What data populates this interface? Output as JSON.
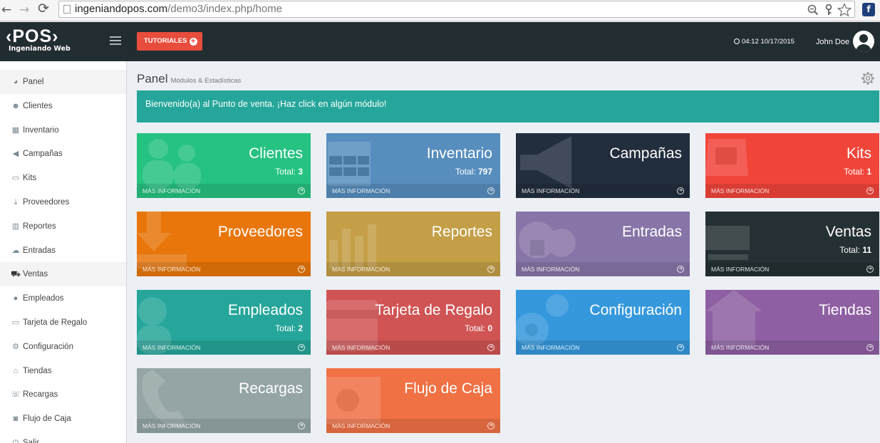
{
  "browser": {
    "url_host": "ingeniandopos.com",
    "url_path": "/demo3/index.php/home",
    "back_glyph": "←",
    "forward_glyph": "→",
    "reload_glyph": "⟳",
    "ext_glyph": "f"
  },
  "header": {
    "logo_main": "‹POS›",
    "logo_sub": "Ingeniando Web",
    "tutorial_label": "TUTORIALES",
    "tutorial_plus": "+",
    "datetime": "04:12 10/17/2015",
    "user_name": "John Doe"
  },
  "sidebar": {
    "items": [
      {
        "label": "Panel",
        "icon": "tachometer-icon",
        "glyph": "◕"
      },
      {
        "label": "Clientes",
        "icon": "users-icon",
        "glyph": "☻"
      },
      {
        "label": "Inventario",
        "icon": "table-icon",
        "glyph": "▦"
      },
      {
        "label": "Campañas",
        "icon": "bullhorn-icon",
        "glyph": "◀"
      },
      {
        "label": "Kits",
        "icon": "inbox-icon",
        "glyph": "▭"
      },
      {
        "label": "Proveedores",
        "icon": "download-icon",
        "glyph": "⤓"
      },
      {
        "label": "Reportes",
        "icon": "bar-chart-icon",
        "glyph": "▥"
      },
      {
        "label": "Entradas",
        "icon": "cloud-download-icon",
        "glyph": "☁"
      },
      {
        "label": "Ventas",
        "icon": "shopping-cart-icon",
        "glyph": "⛟"
      },
      {
        "label": "Empleados",
        "icon": "user-icon",
        "glyph": "●"
      },
      {
        "label": "Tarjeta de Regalo",
        "icon": "credit-card-icon",
        "glyph": "▭"
      },
      {
        "label": "Configuración",
        "icon": "cogs-icon",
        "glyph": "⚙"
      },
      {
        "label": "Tiendas",
        "icon": "home-icon",
        "glyph": "⌂"
      },
      {
        "label": "Recargas",
        "icon": "phone-icon",
        "glyph": "☏"
      },
      {
        "label": "Flujo de Caja",
        "icon": "money-icon",
        "glyph": "◙"
      },
      {
        "label": "Salir",
        "icon": "power-off-icon",
        "glyph": "⏻"
      }
    ]
  },
  "main": {
    "title": "Panel",
    "subtitle": "Módulos & Estadísticas",
    "welcome": "Bienvenido(a) al Punto de venta. ¡Haz click en algún módulo!",
    "more_info": "MÁS INFORMACIÓN",
    "total_label": "Total:",
    "tiles": [
      {
        "name": "Clientes",
        "total": "3",
        "color": "#26c281",
        "icon": "users-icon"
      },
      {
        "name": "Inventario",
        "total": "797",
        "color": "#578ebe",
        "icon": "table-icon"
      },
      {
        "name": "Campañas",
        "total": "",
        "color": "#222d3d",
        "icon": "bullhorn-icon"
      },
      {
        "name": "Kits",
        "total": "1",
        "color": "#f1453a",
        "icon": "inbox-icon"
      },
      {
        "name": "Proveedores",
        "total": "",
        "color": "#e8760b",
        "icon": "download-icon"
      },
      {
        "name": "Reportes",
        "total": "",
        "color": "#c49f47",
        "icon": "bar-chart-icon"
      },
      {
        "name": "Entradas",
        "total": "",
        "color": "#8775a7",
        "icon": "cloud-download-icon"
      },
      {
        "name": "Ventas",
        "total": "11",
        "color": "#243033",
        "icon": "shopping-cart-icon"
      },
      {
        "name": "Empleados",
        "total": "2",
        "color": "#26a69a",
        "icon": "user-icon"
      },
      {
        "name": "Tarjeta de Regalo",
        "total": "0",
        "color": "#d05454",
        "icon": "credit-card-icon"
      },
      {
        "name": "Configuración",
        "total": "",
        "color": "#3598dc",
        "icon": "cogs-icon"
      },
      {
        "name": "Tiendas",
        "total": "",
        "color": "#8e5fa2",
        "icon": "home-icon"
      },
      {
        "name": "Recargas",
        "total": "",
        "color": "#95a5a6",
        "icon": "phone-icon"
      },
      {
        "name": "Flujo de Caja",
        "total": "",
        "color": "#f07144",
        "icon": "money-icon"
      }
    ]
  }
}
